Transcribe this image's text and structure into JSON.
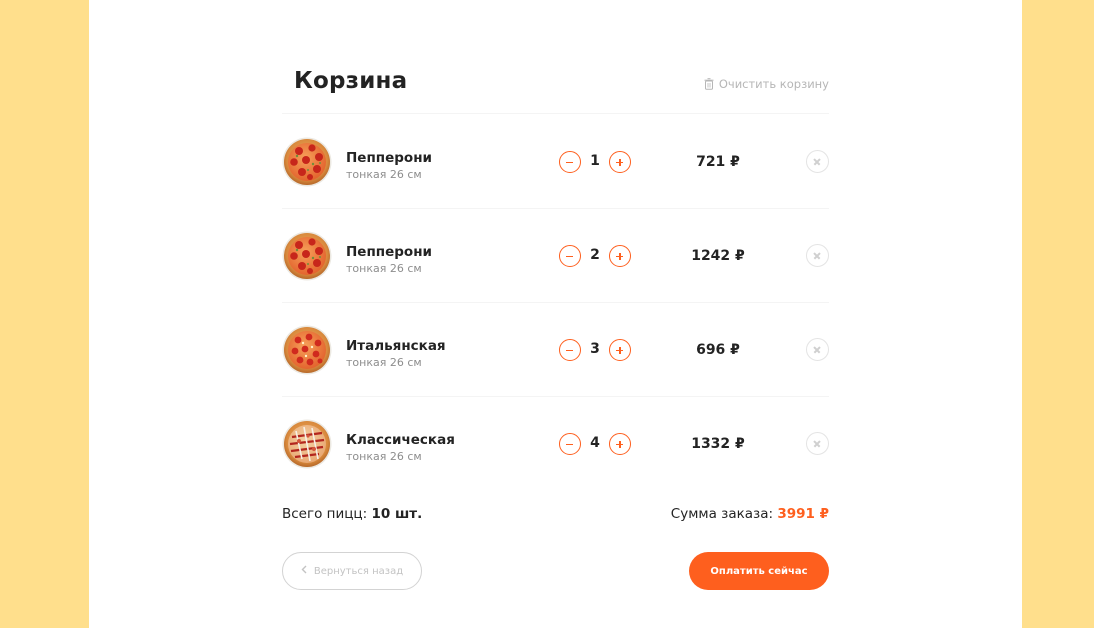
{
  "cart": {
    "title": "Корзина",
    "clear_label": "Очистить корзину",
    "items": [
      {
        "name": "Пепперони",
        "desc": "тонкая 26 см",
        "count": "1",
        "price": "721 ₽",
        "image": "pepperoni-pizza-icon"
      },
      {
        "name": "Пепперони",
        "desc": "тонкая 26 см",
        "count": "2",
        "price": "1242 ₽",
        "image": "pepperoni-pizza-icon"
      },
      {
        "name": "Итальянская",
        "desc": "тонкая 26 см",
        "count": "3",
        "price": "696 ₽",
        "image": "italian-pizza-icon"
      },
      {
        "name": "Классическая",
        "desc": "тонкая 26 см",
        "count": "4",
        "price": "1332 ₽",
        "image": "classic-pizza-icon"
      }
    ],
    "total_count_label": "Всего пицц:",
    "total_count_value": "10 шт.",
    "total_sum_label": "Сумма заказа:",
    "total_sum_value": "3991 ₽",
    "back_label": "Вернуться назад",
    "pay_label": "Оплатить сейчас"
  },
  "colors": {
    "accent": "#fe5f1e",
    "page_background": "#ffdf8c",
    "sheet_background": "#ffffff"
  }
}
